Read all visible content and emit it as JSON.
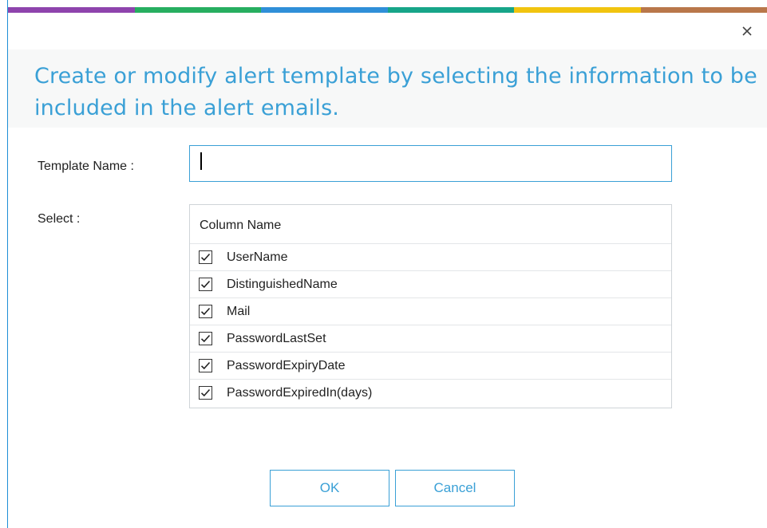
{
  "window": {
    "stripe_colors": [
      "#8e44ad",
      "#27ae60",
      "#2f8fd8",
      "#17a589",
      "#f1c40f",
      "#b9774a"
    ],
    "close_icon": "close-icon",
    "accent_color": "#3aa0d6"
  },
  "dialog": {
    "heading": "Create or modify alert template by selecting the information to be included in the alert emails."
  },
  "form": {
    "template_name_label": "Template Name :",
    "template_name_value": "",
    "template_name_placeholder": "",
    "select_label": "Select :"
  },
  "columns": {
    "header": "Column Name",
    "items": [
      {
        "label": "UserName",
        "checked": true
      },
      {
        "label": "DistinguishedName",
        "checked": true
      },
      {
        "label": "Mail",
        "checked": true
      },
      {
        "label": "PasswordLastSet",
        "checked": true
      },
      {
        "label": "PasswordExpiryDate",
        "checked": true
      },
      {
        "label": "PasswordExpiredIn(days)",
        "checked": true
      }
    ]
  },
  "buttons": {
    "ok_label": "OK",
    "cancel_label": "Cancel"
  }
}
